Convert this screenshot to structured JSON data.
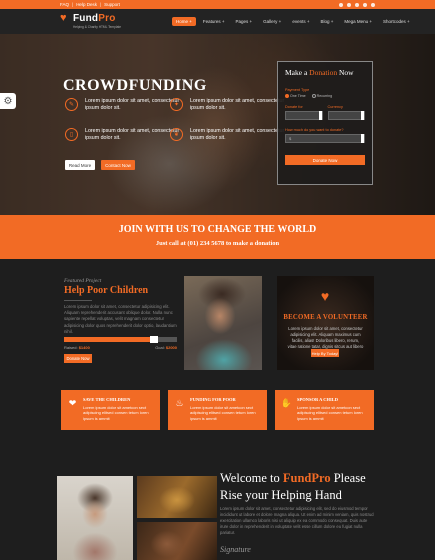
{
  "topbar": {
    "links": [
      "FAQ",
      "Help Desk",
      "Support"
    ],
    "social_icons": [
      "facebook-icon",
      "twitter-icon",
      "google-plus-icon",
      "linkedin-icon",
      "youtube-icon"
    ]
  },
  "nav": {
    "logo_fund": "Fund",
    "logo_pro": "Pro",
    "logo_tagline": "Helping & Charity HTML Template",
    "items": [
      {
        "label": "Home +",
        "active": true
      },
      {
        "label": "Features +"
      },
      {
        "label": "Pages +"
      },
      {
        "label": "Gallery +"
      },
      {
        "label": "events +"
      },
      {
        "label": "Blog +"
      },
      {
        "label": "Mega Menu +"
      },
      {
        "label": "Shortcodes +"
      }
    ]
  },
  "hero": {
    "title": "CROWDFUNDING",
    "features": [
      "Lorem ipsum dolor sit amet, consectetur ipsum dolor sit.",
      "Lorem ipsum dolor sit amet, consectetur ipsum dolor sit.",
      "Lorem ipsum dolor sit amet, consectetur ipsum dolor sit.",
      "Lorem ipsum dolor sit amet, consectetur ipsum dolor sit."
    ],
    "btn_more": "Read More",
    "btn_contact": "Contact Now"
  },
  "donation": {
    "title_pre": "Make a ",
    "title_hl": "Donation",
    "title_post": " Now",
    "payment_label": "Payment Type",
    "opt_one": "One Time",
    "opt_recurring": "Recurring",
    "donate_for_label": "Donate for",
    "currency_label": "Currency",
    "amount_label": "How much do you want to donate?",
    "amount_value": "$",
    "submit": "Donate Now"
  },
  "banner": {
    "headline": "JOIN WITH US TO CHANGE THE WORLD",
    "sub": "Just call at (01) 234 5678 to make a donation"
  },
  "featured": {
    "kicker": "Featured Project",
    "title": "Help Poor Children",
    "text": "Lorem ipsum dolor sit amet, consectetur adipisicing elit. Aliquam reprehenderit accusant oblique dolor. Nulla nunc sapiente repellat voluptas, velit magnam consectetur adipisicing dolor quos reprehenderit dolor optio, laudantium nihil.",
    "progress": 0.8,
    "raised_label": "Raised:",
    "raised_value": "$1400",
    "goal_label": "Goal:",
    "goal_value": "$2000",
    "button": "Donate Now"
  },
  "volunteer": {
    "title": "BECOME A VOLUNTEER",
    "text": "Lorem ipsum dolor sit amet, consectetur adipisicing elit. Aliquam maximus cum facilis, alias! Doloribus libero, rerum, vitae ratione tatar, dignis sitcus aut libero a dolor.",
    "button": "Help By Today!"
  },
  "cards": [
    {
      "icon": "hand-heart-icon",
      "glyph": "❤",
      "title": "SAVE THE CHILDREN",
      "text": "Lorem ipsum dolor sit ametcon sect adipiscing elitsed consen tetum loren ipsum is ammit"
    },
    {
      "icon": "food-icon",
      "glyph": "♨",
      "title": "FUNDING FOR POOR",
      "text": "Lorem ipsum dolor sit ametcon sect adipiscing elitsed consen tetum loren ipsum is ammit"
    },
    {
      "icon": "sponsor-icon",
      "glyph": "✋",
      "title": "SPONSOR A CHILD",
      "text": "Lorem ipsum dolor sit ametcon sect adipiscing elitsed consen tetum loren ipsum is ammit"
    }
  ],
  "welcome": {
    "pre": "Welcome to ",
    "brand": "FundPro",
    "post": " Please Rise your Helping Hand",
    "text": "Lorem ipsum dolor sit amet, consectetur adipisicing elit, sed do eiusmod tempor incididunt ut labore et dolore magna aliqua. Ut enim ad minim veniam, quis nostrud exercitation ullamco laboris nisi ut aliquip ex ea commodo consequat. Duis aute irure dolor in reprehenderit in voluptate velit esse cillum dolore eu fugiat nulla pariatur.",
    "signature": "Signature"
  },
  "colors": {
    "accent": "#f26b25",
    "dark": "#1e1e1e"
  }
}
